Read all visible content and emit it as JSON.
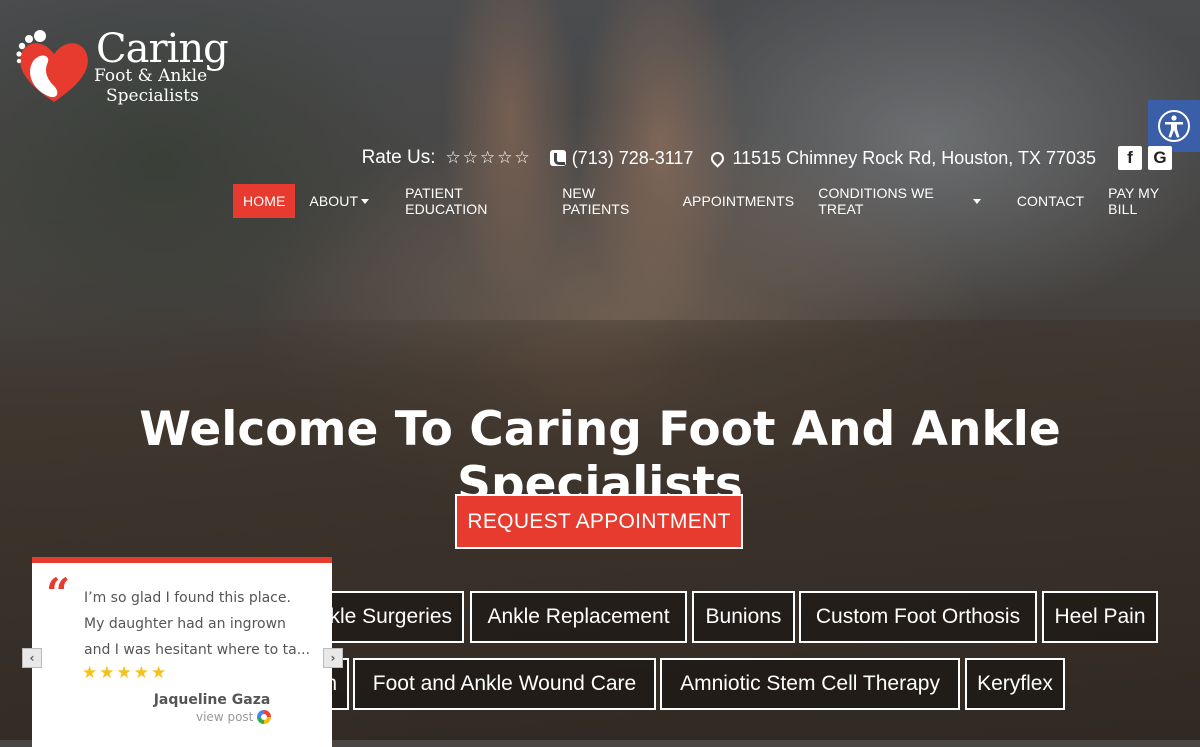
{
  "logo": {
    "name_main": "Caring",
    "name_line1": "Foot & Ankle",
    "name_line2": "Specialists"
  },
  "info": {
    "rate_label": "Rate Us:",
    "rate_stars": "☆☆☆☆☆",
    "phone": "(713) 728-3117",
    "address": "11515 Chimney Rock Rd, Houston, TX 77035",
    "social_facebook": "f",
    "social_google": "G"
  },
  "nav": {
    "home": "HOME",
    "about": "ABOUT",
    "patient_education": "PATIENT EDUCATION",
    "new_patients": "NEW PATIENTS",
    "appointments": "APPOINTMENTS",
    "conditions": "CONDITIONS WE TREAT",
    "contact": "CONTACT",
    "pay_bill": "PAY MY BILL"
  },
  "hero": {
    "headline": "Welcome To Caring Foot And Ankle Specialists",
    "cta": "REQUEST APPOINTMENT"
  },
  "services": {
    "row1": [
      "kle Surgeries",
      "Ankle Replacement",
      "Bunions",
      "Custom Foot Orthosis",
      "Heel Pain"
    ],
    "row2": [
      "n",
      "Foot and Ankle Wound Care",
      "Amniotic Stem Cell Therapy",
      "Keryflex"
    ]
  },
  "review": {
    "quote_mark": "“",
    "line1": "I’m so glad I found this place.",
    "line2": "My daughter had an ingrown",
    "line3": "and I was hesitant where to ta...",
    "stars": "★★★★★",
    "reviewer": "Jaqueline Gaza",
    "view_post": "view post",
    "prev": "‹",
    "next": "›"
  },
  "colors": {
    "accent": "#e63b2e",
    "access_blue": "#3a5ea8",
    "star_yellow": "#f4c21b"
  }
}
